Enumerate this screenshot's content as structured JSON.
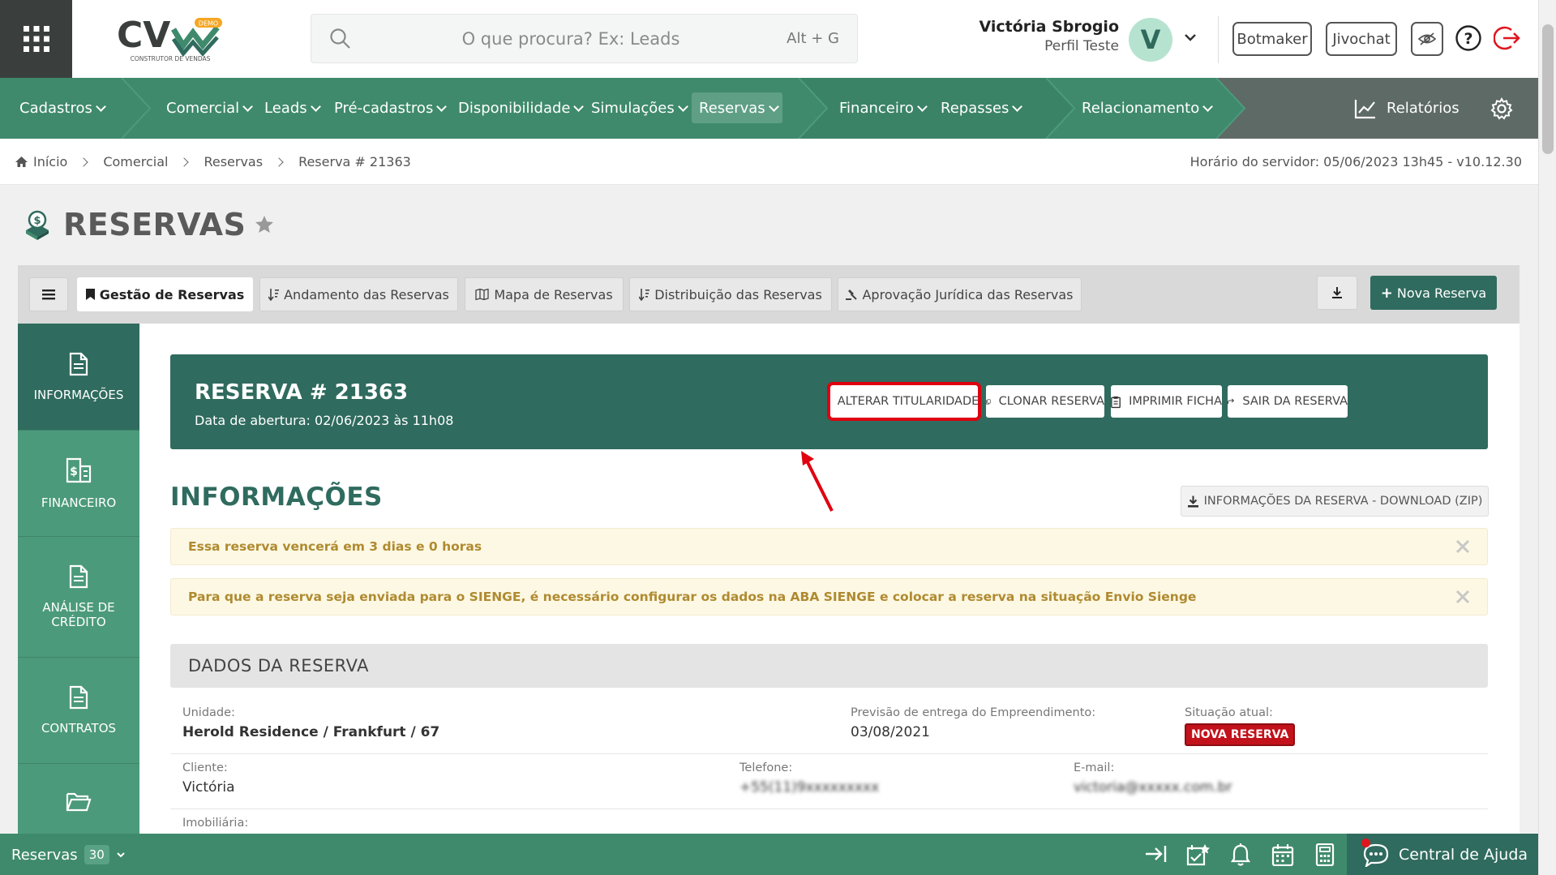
{
  "header": {
    "logo_text": "CV",
    "logo_sub": "CONSTRUTOR DE VENDAS",
    "logo_badge": "DEMO",
    "search_placeholder": "O que procura? Ex: Leads",
    "search_shortcut": "Alt + G",
    "user_name": "Victória Sbrogio",
    "user_profile": "Perfil Teste",
    "avatar_letter": "V",
    "botmaker_label": "Botmaker",
    "jivochat_label": "Jivochat"
  },
  "nav": {
    "items": [
      "Cadastros",
      "Comercial",
      "Leads",
      "Pré-cadastros",
      "Disponibilidade",
      "Simulações",
      "Reservas",
      "Financeiro",
      "Repasses",
      "Relacionamento"
    ],
    "reports_label": "Relatórios"
  },
  "breadcrumb": {
    "items": [
      "Início",
      "Comercial",
      "Reservas",
      "Reserva # 21363"
    ],
    "server_time": "Horário do servidor: 05/06/2023 13h45 - v10.12.30"
  },
  "page": {
    "title": "RESERVAS"
  },
  "tabs": [
    "Gestão de Reservas",
    "Andamento das Reservas",
    "Mapa de Reservas",
    "Distribuição das Reservas",
    "Aprovação Jurídica das Reservas"
  ],
  "new_reserva_label": "Nova Reserva",
  "sidebar": [
    "INFORMAÇÕES",
    "FINANCEIRO",
    "ANÁLISE DE CRÉDITO",
    "CONTRATOS"
  ],
  "reserva": {
    "title": "RESERVA # 21363",
    "opening": "Data de abertura: 02/06/2023 às 11h08",
    "actions": [
      "ALTERAR TITULARIDADE",
      "CLONAR RESERVA",
      "IMPRIMIR FICHA",
      "SAIR DA RESERVA"
    ]
  },
  "info": {
    "section_title": "INFORMAÇÕES",
    "zip_label": "INFORMAÇÕES DA RESERVA - DOWNLOAD (ZIP)",
    "alerts": [
      "Essa reserva vencerá em 3 dias e 0 horas",
      "Para que a reserva seja enviada para o SIENGE, é necessário configurar os dados na ABA SIENGE e colocar a reserva na situação Envio Sienge"
    ],
    "dados_title": "DADOS DA RESERVA",
    "unidade_label": "Unidade:",
    "unidade_value": "Herold Residence / Frankfurt / 67",
    "previsao_label": "Previsão de entrega do Empreendimento:",
    "previsao_value": "03/08/2021",
    "situacao_label": "Situação atual:",
    "situacao_value": "NOVA RESERVA",
    "cliente_label": "Cliente:",
    "cliente_value": "Victória",
    "telefone_label": "Telefone:",
    "telefone_value": "+55(11)9xxxxxxxxx",
    "email_label": "E-mail:",
    "email_value": "victoria@xxxxx.com.br",
    "imobiliaria_label": "Imobiliária:"
  },
  "bottom": {
    "reservas_label": "Reservas",
    "reservas_count": "30",
    "help_label": "Central de Ajuda"
  },
  "colors": {
    "primary": "#2f6b5e",
    "nav": "#3f8a6c",
    "highlight": "#e00010",
    "badge": "#c2121b"
  }
}
